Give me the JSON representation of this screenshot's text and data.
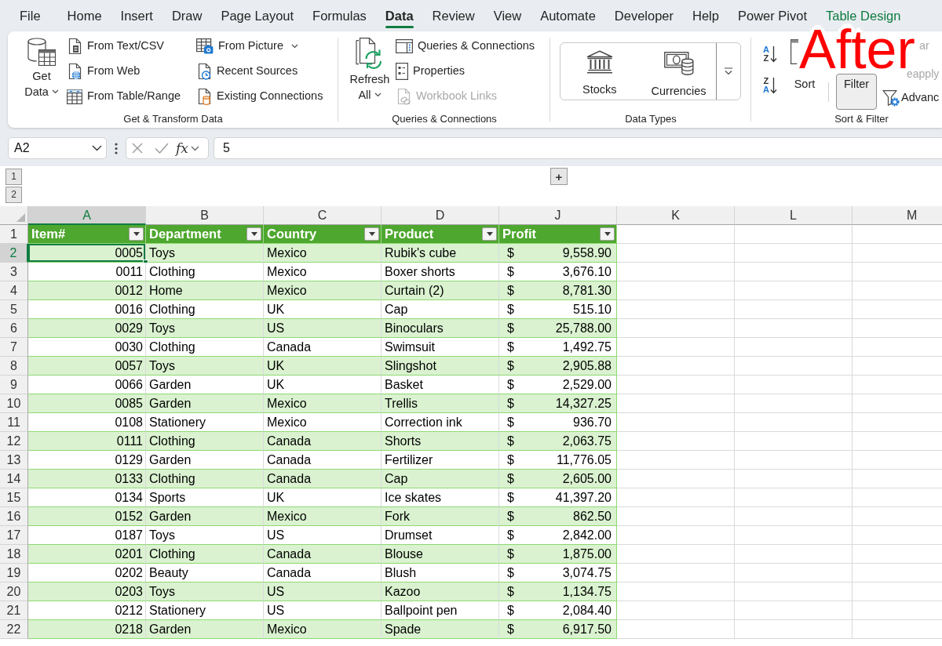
{
  "annotation": "After",
  "tabs": [
    {
      "label": "File",
      "selected": false,
      "contextual": false
    },
    {
      "label": "Home",
      "selected": false,
      "contextual": false
    },
    {
      "label": "Insert",
      "selected": false,
      "contextual": false
    },
    {
      "label": "Draw",
      "selected": false,
      "contextual": false
    },
    {
      "label": "Page Layout",
      "selected": false,
      "contextual": false
    },
    {
      "label": "Formulas",
      "selected": false,
      "contextual": false
    },
    {
      "label": "Data",
      "selected": true,
      "contextual": false
    },
    {
      "label": "Review",
      "selected": false,
      "contextual": false
    },
    {
      "label": "View",
      "selected": false,
      "contextual": false
    },
    {
      "label": "Automate",
      "selected": false,
      "contextual": false
    },
    {
      "label": "Developer",
      "selected": false,
      "contextual": false
    },
    {
      "label": "Help",
      "selected": false,
      "contextual": false
    },
    {
      "label": "Power Pivot",
      "selected": false,
      "contextual": false
    },
    {
      "label": "Table Design",
      "selected": false,
      "contextual": true
    }
  ],
  "ribbon": {
    "groups": [
      {
        "label": "Get & Transform Data",
        "commands": [
          {
            "label": "Get Data",
            "dropdown": true,
            "disabled": false
          },
          {
            "label": "From Text/CSV",
            "dropdown": false,
            "disabled": false
          },
          {
            "label": "From Web",
            "dropdown": false,
            "disabled": false
          },
          {
            "label": "From Table/Range",
            "dropdown": false,
            "disabled": false
          },
          {
            "label": "From Picture",
            "dropdown": true,
            "disabled": false
          },
          {
            "label": "Recent Sources",
            "dropdown": false,
            "disabled": false
          },
          {
            "label": "Existing Connections",
            "dropdown": false,
            "disabled": false
          }
        ]
      },
      {
        "label": "Queries & Connections",
        "commands": [
          {
            "label": "Refresh All",
            "dropdown": true,
            "disabled": false
          },
          {
            "label": "Queries & Connections",
            "dropdown": false,
            "disabled": false
          },
          {
            "label": "Properties",
            "dropdown": false,
            "disabled": false
          },
          {
            "label": "Workbook Links",
            "dropdown": false,
            "disabled": true
          }
        ]
      },
      {
        "label": "Data Types",
        "commands": [
          {
            "label": "Stocks",
            "disabled": false
          },
          {
            "label": "Currencies",
            "disabled": false
          }
        ]
      },
      {
        "label": "Sort & Filter",
        "sort_buttons": [
          {
            "letters": [
              {
                "char": "A",
                "accent": true
              },
              {
                "char": "Z",
                "accent": false
              }
            ]
          },
          {
            "letters": [
              {
                "char": "Z",
                "accent": false
              },
              {
                "char": "A",
                "accent": true
              }
            ]
          }
        ],
        "commands": [
          {
            "label": "Sort",
            "pressed": false,
            "disabled": false
          },
          {
            "label": "Filter",
            "pressed": true,
            "disabled": false
          },
          {
            "label": "ar",
            "disabled": true
          },
          {
            "label": "eapply",
            "disabled": true
          },
          {
            "label": "Advanc",
            "disabled": false
          }
        ]
      }
    ]
  },
  "formula_bar": {
    "name_box": "A2",
    "function_label": "fx",
    "formula": "5"
  },
  "outline": {
    "levels": [
      "1",
      "2"
    ],
    "expand_button": "+"
  },
  "sheet": {
    "columns": [
      {
        "letter": "A",
        "selected": true
      },
      {
        "letter": "B",
        "selected": false
      },
      {
        "letter": "C",
        "selected": false
      },
      {
        "letter": "D",
        "selected": false
      },
      {
        "letter": "J",
        "selected": false
      },
      {
        "letter": "K",
        "selected": false
      },
      {
        "letter": "L",
        "selected": false
      },
      {
        "letter": "M",
        "selected": false
      }
    ],
    "header_row": {
      "row": "1",
      "cells": [
        "Item#",
        "Department",
        "Country",
        "Product",
        "Profit"
      ]
    },
    "rows": [
      {
        "row": "2",
        "selected": true,
        "cells": [
          "0005",
          "Toys",
          "Mexico",
          "Rubik's cube"
        ],
        "currency": "$",
        "profit": "9,558.90"
      },
      {
        "row": "3",
        "selected": false,
        "cells": [
          "0011",
          "Clothing",
          "Mexico",
          "Boxer shorts"
        ],
        "currency": "$",
        "profit": "3,676.10"
      },
      {
        "row": "4",
        "selected": false,
        "cells": [
          "0012",
          "Home",
          "Mexico",
          "Curtain (2)"
        ],
        "currency": "$",
        "profit": "8,781.30"
      },
      {
        "row": "5",
        "selected": false,
        "cells": [
          "0016",
          "Clothing",
          "UK",
          "Cap"
        ],
        "currency": "$",
        "profit": "515.10"
      },
      {
        "row": "6",
        "selected": false,
        "cells": [
          "0029",
          "Toys",
          "US",
          "Binoculars"
        ],
        "currency": "$",
        "profit": "25,788.00"
      },
      {
        "row": "7",
        "selected": false,
        "cells": [
          "0030",
          "Clothing",
          "Canada",
          "Swimsuit"
        ],
        "currency": "$",
        "profit": "1,492.75"
      },
      {
        "row": "8",
        "selected": false,
        "cells": [
          "0057",
          "Toys",
          "UK",
          "Slingshot"
        ],
        "currency": "$",
        "profit": "2,905.88"
      },
      {
        "row": "9",
        "selected": false,
        "cells": [
          "0066",
          "Garden",
          "UK",
          "Basket"
        ],
        "currency": "$",
        "profit": "2,529.00"
      },
      {
        "row": "10",
        "selected": false,
        "cells": [
          "0085",
          "Garden",
          "Mexico",
          "Trellis"
        ],
        "currency": "$",
        "profit": "14,327.25"
      },
      {
        "row": "11",
        "selected": false,
        "cells": [
          "0108",
          "Stationery",
          "Mexico",
          "Correction ink"
        ],
        "currency": "$",
        "profit": "936.70"
      },
      {
        "row": "12",
        "selected": false,
        "cells": [
          "0111",
          "Clothing",
          "Canada",
          "Shorts"
        ],
        "currency": "$",
        "profit": "2,063.75"
      },
      {
        "row": "13",
        "selected": false,
        "cells": [
          "0129",
          "Garden",
          "Canada",
          "Fertilizer"
        ],
        "currency": "$",
        "profit": "11,776.05"
      },
      {
        "row": "14",
        "selected": false,
        "cells": [
          "0133",
          "Clothing",
          "Canada",
          "Cap"
        ],
        "currency": "$",
        "profit": "2,605.00"
      },
      {
        "row": "15",
        "selected": false,
        "cells": [
          "0134",
          "Sports",
          "UK",
          "Ice skates"
        ],
        "currency": "$",
        "profit": "41,397.20"
      },
      {
        "row": "16",
        "selected": false,
        "cells": [
          "0152",
          "Garden",
          "Mexico",
          "Fork"
        ],
        "currency": "$",
        "profit": "862.50"
      },
      {
        "row": "17",
        "selected": false,
        "cells": [
          "0187",
          "Toys",
          "US",
          "Drumset"
        ],
        "currency": "$",
        "profit": "2,842.00"
      },
      {
        "row": "18",
        "selected": false,
        "cells": [
          "0201",
          "Clothing",
          "Canada",
          "Blouse"
        ],
        "currency": "$",
        "profit": "1,875.00"
      },
      {
        "row": "19",
        "selected": false,
        "cells": [
          "0202",
          "Beauty",
          "Canada",
          "Blush"
        ],
        "currency": "$",
        "profit": "3,074.75"
      },
      {
        "row": "20",
        "selected": false,
        "cells": [
          "0203",
          "Toys",
          "US",
          "Kazoo"
        ],
        "currency": "$",
        "profit": "1,134.75"
      },
      {
        "row": "21",
        "selected": false,
        "cells": [
          "0212",
          "Stationery",
          "US",
          "Ballpoint pen"
        ],
        "currency": "$",
        "profit": "2,084.40"
      },
      {
        "row": "22",
        "selected": false,
        "cells": [
          "0218",
          "Garden",
          "Mexico",
          "Spade"
        ],
        "currency": "$",
        "profit": "6,917.50"
      }
    ]
  }
}
